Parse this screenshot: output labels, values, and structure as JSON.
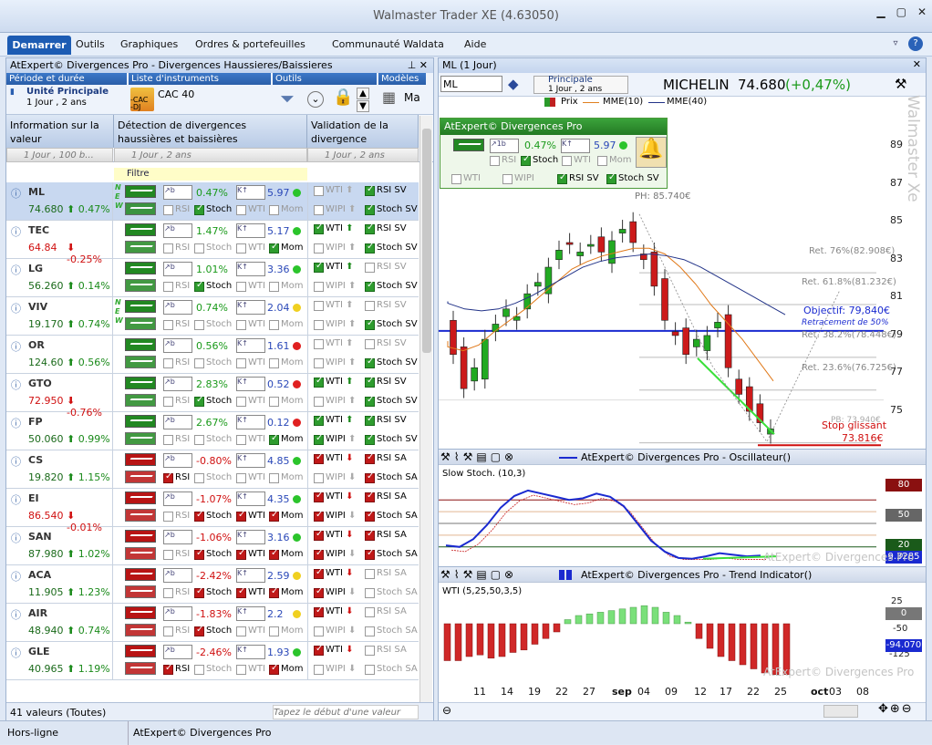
{
  "window": {
    "title": "Walmaster Trader XE  (4.63050)"
  },
  "menu": {
    "active": "Demarrer",
    "items": [
      "Outils",
      "Graphiques",
      "Ordres & portefeuilles",
      "Communauté Waldata",
      "Aide"
    ]
  },
  "left_panel": {
    "title": "AtExpert© Divergences Pro - Divergences Haussieres/Baissieres",
    "sections": {
      "period": {
        "label": "Période et durée",
        "value1": "Unité Principale",
        "value2": "1 Jour , 2 ans"
      },
      "instruments": {
        "label": "Liste d'instruments",
        "value": "CAC 40",
        "list1": "-CAC",
        "list2": "-DJ"
      },
      "tools": {
        "label": "Outils"
      },
      "models": {
        "label": "Modèles",
        "value": "Ma"
      }
    },
    "columns": {
      "info": "Information sur la valeur",
      "detection": "Détection de divergences haussières et baissières",
      "validation": "Validation de la divergence",
      "period_info": "1 Jour , 100 b...",
      "period_det": "1 Jour , 2 ans",
      "period_val": "1 Jour , 2 ans",
      "filter": "Filtre"
    },
    "rows": [
      {
        "sym": "ML",
        "price": "74.680",
        "chg": "0.47%",
        "dir": "up",
        "pct": "0.47%",
        "osc": "5.97",
        "dot": "green",
        "dot2": "green",
        "wti": false,
        "rsi": true,
        "wipi": false,
        "stoch": true,
        "mom_on": false,
        "stoch_on": true,
        "sel": true,
        "nwe": true,
        "tone": "g"
      },
      {
        "sym": "TEC",
        "price": "64.84",
        "chg": "-0.25%",
        "dir": "down",
        "pct": "1.47%",
        "osc": "5.17",
        "dot": "green",
        "wti": true,
        "rsi": true,
        "wipi": false,
        "stoch": true,
        "mom_on": true,
        "stoch_on": false,
        "tone": "g"
      },
      {
        "sym": "LG",
        "price": "56.260",
        "chg": "0.14%",
        "dir": "up",
        "pct": "1.01%",
        "osc": "3.36",
        "dot": "green",
        "wti": true,
        "rsi": false,
        "wipi": false,
        "stoch": true,
        "mom_on": false,
        "stoch_on": true,
        "tone": "g"
      },
      {
        "sym": "VIV",
        "price": "19.170",
        "chg": "0.74%",
        "dir": "up",
        "pct": "0.74%",
        "osc": "2.04",
        "dot": "yellow",
        "wti": false,
        "rsi": false,
        "wipi": false,
        "stoch": true,
        "mom_on": false,
        "stoch_on": false,
        "nwe": true,
        "tone": "g"
      },
      {
        "sym": "OR",
        "price": "124.60",
        "chg": "0.56%",
        "dir": "up",
        "pct": "0.56%",
        "osc": "1.61",
        "dot": "red",
        "wti": false,
        "rsi": false,
        "wipi": false,
        "stoch": true,
        "mom_on": false,
        "stoch_on": false,
        "tone": "g"
      },
      {
        "sym": "GTO",
        "price": "72.950",
        "chg": "-0.76%",
        "dir": "down",
        "pct": "2.83%",
        "osc": "0.52",
        "dot": "red",
        "wti": true,
        "rsi": true,
        "wipi": false,
        "stoch": true,
        "mom_on": false,
        "stoch_on": true,
        "tone": "g"
      },
      {
        "sym": "FP",
        "price": "50.060",
        "chg": "0.99%",
        "dir": "up",
        "pct": "2.67%",
        "osc": "0.12",
        "dot": "red",
        "wti": true,
        "rsi": true,
        "wipi": true,
        "stoch": true,
        "mom_on": true,
        "stoch_on": false,
        "tone": "g"
      },
      {
        "sym": "CS",
        "price": "19.820",
        "chg": "1.15%",
        "dir": "up",
        "pct": "-0.80%",
        "osc": "4.85",
        "dot": "green",
        "wti": true,
        "rsi": true,
        "wipi": false,
        "stoch": true,
        "mom_on": false,
        "stoch_on": false,
        "rsi_on": true,
        "tone": "r"
      },
      {
        "sym": "EI",
        "price": "86.540",
        "chg": "-0.01%",
        "dir": "down",
        "pct": "-1.07%",
        "osc": "4.35",
        "dot": "green",
        "wti": true,
        "rsi": true,
        "wipi": true,
        "stoch": true,
        "mom_on": true,
        "stoch_on": true,
        "tone": "r"
      },
      {
        "sym": "SAN",
        "price": "87.980",
        "chg": "1.02%",
        "dir": "up",
        "pct": "-1.06%",
        "osc": "3.16",
        "dot": "green",
        "wti": true,
        "rsi": true,
        "wipi": true,
        "stoch": true,
        "mom_on": true,
        "stoch_on": true,
        "tone": "r"
      },
      {
        "sym": "ACA",
        "price": "11.905",
        "chg": "1.23%",
        "dir": "up",
        "pct": "-2.42%",
        "osc": "2.59",
        "dot": "yellow",
        "wti": true,
        "rsi": false,
        "wipi": true,
        "stoch": false,
        "mom_on": true,
        "stoch_on": true,
        "tone": "r"
      },
      {
        "sym": "AIR",
        "price": "48.940",
        "chg": "0.74%",
        "dir": "up",
        "pct": "-1.83%",
        "osc": "2.2",
        "dot": "yellow",
        "wti": true,
        "rsi": false,
        "wipi": false,
        "stoch": false,
        "mom_on": false,
        "stoch_on": true,
        "tone": "r"
      },
      {
        "sym": "GLE",
        "price": "40.965",
        "chg": "1.19%",
        "dir": "up",
        "pct": "-2.46%",
        "osc": "1.93",
        "dot": "green",
        "wti": true,
        "rsi": false,
        "wipi": false,
        "stoch": false,
        "mom_on": true,
        "stoch_on": false,
        "rsi_on": true,
        "tone": "r"
      }
    ],
    "footer": {
      "count": "41 valeurs (Toutes)",
      "search_placeholder": "Tapez le début d'une valeur"
    }
  },
  "right_panel": {
    "title": "ML (1 Jour)",
    "symbol_input": "ML",
    "chart_period": {
      "label": "Principale",
      "value": "1 Jour , 2 ans"
    },
    "stock": {
      "name": "MICHELIN",
      "price": "74.680",
      "change": "(+0,47%)"
    },
    "legend": {
      "price": "Prix",
      "ma10": "MME(10)",
      "ma40": "MME(40)"
    },
    "overlay": {
      "title": "AtExpert© Divergences Pro",
      "pct": "0.47%",
      "osc": "5.97",
      "rsi": "RSI",
      "stoch": "Stoch",
      "wti": "WTI",
      "mom": "Mom",
      "wti2": "WTI",
      "wipi": "WIPI",
      "rsisv": "RSI SV",
      "stochsv": "Stoch SV"
    },
    "price_axis": [
      "89",
      "87",
      "85",
      "83",
      "81",
      "79",
      "77",
      "75"
    ],
    "annotations": {
      "ph": "PH: 85.740€",
      "r76": "Ret. 76%(82.908€)",
      "r61": "Ret. 61.8%(81.232€)",
      "objectif": "Objectif: 79,840€",
      "ret50": "Retracement de 50%",
      "r38": "Ret. 38.2%(78.448€)",
      "r23": "Ret. 23.6%(76.725€)",
      "pb": "PB: 73.940€",
      "stop": "Stop glissant",
      "stopval": "73.816€"
    },
    "osc_panel": {
      "title": "AtExpert© Divergences Pro - Oscillateur()",
      "label": "Slow Stoch. (10,3)",
      "tags": [
        "80",
        "50",
        "20",
        "9.3285"
      ],
      "watermark": "AtExpert© Divergences Pro"
    },
    "trend_panel": {
      "title": "AtExpert© Divergences Pro - Trend Indicator()",
      "label": "WTI (5,25,50,3,5)",
      "axis": [
        "25",
        "0",
        "-50",
        "-125"
      ],
      "tags": [
        "0",
        "-94.070"
      ],
      "watermark": "AtExpert© Divergences Pro"
    },
    "x_axis": [
      "11",
      "14",
      "19",
      "22",
      "27",
      "sep",
      "04",
      "09",
      "12",
      "17",
      "22",
      "25",
      "oct",
      "03",
      "08"
    ],
    "brand_watermark": "Walmaster Xe"
  },
  "chart_data": [
    {
      "type": "candlestick",
      "title": "MICHELIN 74.680 (+0,47%)",
      "series_names": [
        "Prix",
        "MME(10)",
        "MME(40)"
      ],
      "x": [
        "11",
        "14",
        "19",
        "22",
        "27",
        "sep",
        "04",
        "09",
        "12",
        "17",
        "22",
        "25"
      ],
      "close": [
        78.2,
        77.3,
        80.9,
        82.9,
        84.4,
        84.1,
        85.2,
        83.0,
        79.5,
        79.4,
        75.8,
        74.68
      ],
      "ylim": [
        74,
        90
      ]
    },
    {
      "type": "line",
      "title": "Slow Stoch. (10,3)",
      "ylim": [
        0,
        100
      ],
      "levels": [
        80,
        50,
        20
      ],
      "last": 9.3285
    },
    {
      "type": "bar",
      "title": "WTI (5,25,50,3,5)",
      "ylim": [
        -125,
        25
      ],
      "last": -94.07
    }
  ],
  "status": {
    "left": "Hors-ligne",
    "right": "AtExpert© Divergences Pro"
  }
}
